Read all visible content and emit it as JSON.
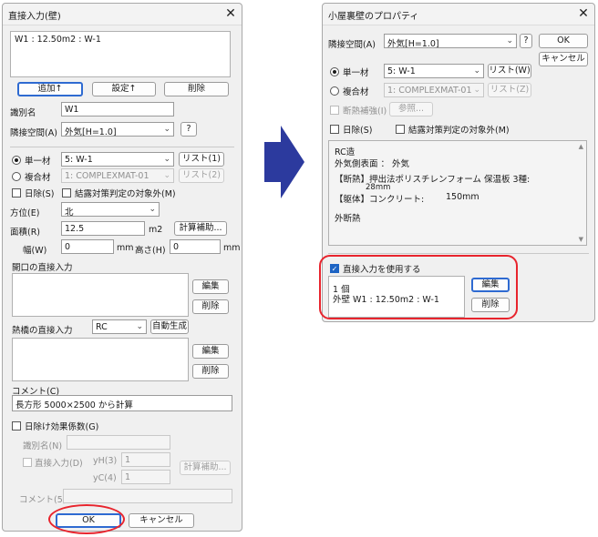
{
  "left": {
    "title": "直接入力(壁)",
    "top_text": "W1 : 12.50m2 : W-1",
    "add_btn": "追加↑",
    "set_btn": "設定↑",
    "del_btn": "削除",
    "id_label": "識別名",
    "id_value": "W1",
    "adjacent_label": "隣接空間(A)",
    "adjacent_value": "外気[H=1.0]",
    "help_btn": "?",
    "single_label": "単一材",
    "single_value": "5: W-1",
    "list1_btn": "リスト(1)",
    "composite_label": "複合材",
    "composite_value": "1: COMPLEXMAT-01",
    "list2_btn": "リスト(2)",
    "sun_label": "日除(S)",
    "cond_label": "結露対策判定の対象外(M)",
    "dir_label": "方位(E)",
    "dir_value": "北",
    "area_label": "面積(R)",
    "area_value": "12.5",
    "area_unit": "m2",
    "calc_btn": "計算補助...",
    "width_label": "幅(W)",
    "width_value": "0",
    "width_unit": "mm",
    "height_label": "高さ(H)",
    "height_value": "0",
    "height_unit": "mm",
    "opening_label": "開口の直接入力",
    "edit_btn": "編集",
    "delete_btn": "削除",
    "bridge_label": "熱橋の直接入力",
    "bridge_value": "RC",
    "auto_btn": "自動生成",
    "edit_btn2": "編集",
    "delete_btn2": "削除",
    "comment_label": "コメント(C)",
    "comment_value": "長方形 5000×2500 から計算",
    "shade_label": "日除け効果係数(G)",
    "id2_label": "識別名(N)",
    "direct_label": "直接入力(D)",
    "yh_label": "yH(3)",
    "yh_value": "1",
    "yc_label": "yC(4)",
    "yc_value": "1",
    "calc2_btn": "計算補助...",
    "comment2_label": "コメント(5)",
    "ok_btn": "OK",
    "cancel_btn": "キャンセル"
  },
  "right": {
    "title": "小屋裏壁のプロパティ",
    "adjacent_label": "隣接空間(A)",
    "adjacent_value": "外気[H=1.0]",
    "help_btn": "?",
    "ok_btn": "OK",
    "cancel_btn": "キャンセル",
    "single_label": "単一材",
    "single_value": "5: W-1",
    "list_btn": "リスト(W)",
    "composite_label": "複合材",
    "composite_value": "1: COMPLEXMAT-01",
    "list2_btn": "リスト(Z)",
    "insul_label": "断熱補強(I)",
    "ref_btn": "参照...",
    "sun_label": "日除(S)",
    "cond_label": "結露対策判定の対象外(M)",
    "info_line1": "RC造",
    "info_line2": "外気側表面 ： 外気",
    "info_line3": "【断熱】押出法ポリスチレンフォーム 保温板 3種:",
    "info_line3b": "28mm",
    "info_line4": "【躯体】コンクリート:",
    "info_line4b": "150mm",
    "info_line5": "外断熱",
    "direct_use_label": "直接入力を使用する",
    "direct_line1": "1 個",
    "direct_line2": "外壁  W1 : 12.50m2 : W-1",
    "edit_btn": "編集",
    "delete_btn": "削除"
  },
  "colors": {
    "arrow": "#2c3a9e",
    "highlight": "#e8242d",
    "accent": "#1d64c4"
  }
}
